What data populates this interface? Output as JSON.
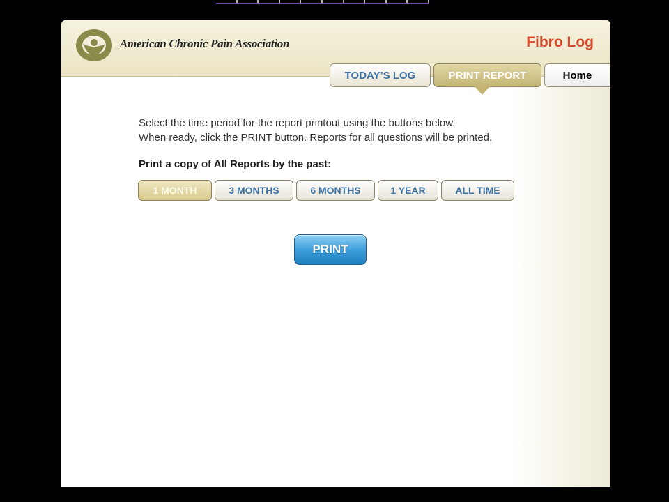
{
  "header": {
    "organization": "American Chronic Pain Association",
    "app_title": "Fibro Log"
  },
  "tabs": [
    {
      "label": "TODAY’S LOG",
      "active": false
    },
    {
      "label": "PRINT REPORT",
      "active": true
    },
    {
      "label": "Home",
      "active": false
    }
  ],
  "instructions": {
    "line1": "Select the time period for the report printout using the buttons below.",
    "line2": "When ready, click the PRINT button. Reports for all questions will be printed."
  },
  "period": {
    "heading": "Print a copy of All Reports by the past:",
    "options": [
      "1 MONTH",
      "3 MONTHS",
      "6 MONTHS",
      "1 YEAR",
      "ALL TIME"
    ],
    "selected": "1 MONTH"
  },
  "print_button": {
    "label": "PRINT"
  },
  "colors": {
    "brand_red": "#d6492a",
    "link_blue": "#3d73a5",
    "header_tan": "#ece5c4",
    "active_gold": "#c4b575",
    "print_blue": "#3fa0dc",
    "logo_olive": "#8a8a4a"
  },
  "icons": {
    "logo": "acpa-logo-icon"
  }
}
